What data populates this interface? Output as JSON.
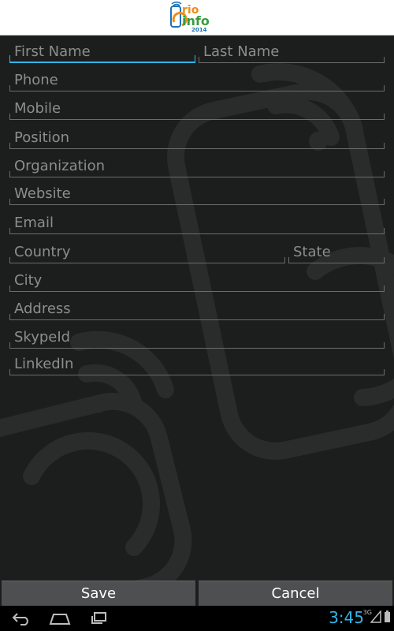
{
  "header": {
    "logo_top": "rio",
    "logo_bottom": "info",
    "logo_year": "2014"
  },
  "form": {
    "first_name": "First Name",
    "last_name": "Last Name",
    "phone": "Phone",
    "mobile": "Mobile",
    "position": "Position",
    "organization": "Organization",
    "website": "Website",
    "email": "Email",
    "country": "Country",
    "state": "State",
    "city": "City",
    "address": "Address",
    "skype": "SkypeId",
    "linkedin": "LinkedIn"
  },
  "buttons": {
    "save": "Save",
    "cancel": "Cancel"
  },
  "status": {
    "time": "3:45",
    "network": "3G"
  },
  "colors": {
    "accent": "#33b5e5",
    "logo_orange": "#f08c1a",
    "logo_green": "#3a9b3f",
    "logo_blue": "#1a73b8"
  },
  "icons": [
    "back-icon",
    "home-icon",
    "recent-apps-icon",
    "signal-icon",
    "battery-icon"
  ]
}
